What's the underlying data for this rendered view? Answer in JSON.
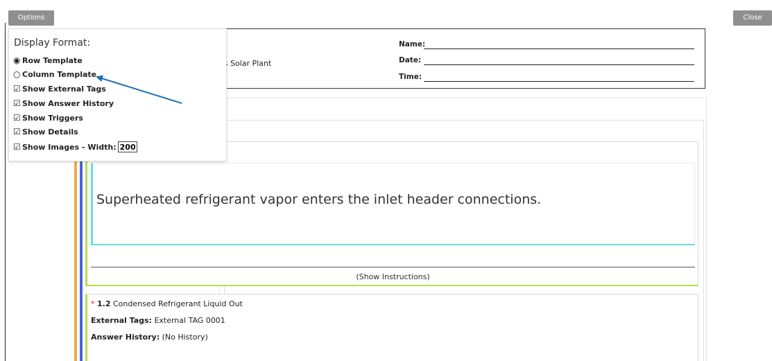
{
  "toolbar": {
    "options_label": "Options",
    "close_label": "Close"
  },
  "header": {
    "plant_text": "os Solar Plant",
    "signature_fields": [
      {
        "label": "Name:"
      },
      {
        "label": "Date:"
      },
      {
        "label": "Time:"
      }
    ]
  },
  "options_panel": {
    "title": "Display Format:",
    "row_template": {
      "label": "Row Template",
      "selected": true
    },
    "column_template": {
      "label": "Column Template",
      "selected": false
    },
    "checkboxes": [
      {
        "label": "Show External Tags",
        "checked": true
      },
      {
        "label": "Show Answer History",
        "checked": true
      },
      {
        "label": "Show Triggers",
        "checked": true
      },
      {
        "label": "Show Details",
        "checked": true
      },
      {
        "label": "Show Images - Width:",
        "checked": true
      }
    ],
    "image_width_value": "200"
  },
  "question1": {
    "text": "Superheated refrigerant vapor enters the inlet header connections.",
    "instructions_toggle": "(Show Instructions)"
  },
  "question2": {
    "required_marker": "*",
    "number": "1.2",
    "title": "Condensed Refrigerant Liquid Out",
    "external_tags_label": "External Tags:",
    "external_tags_value": "External TAG 0001",
    "answer_history_label": "Answer History:",
    "answer_history_value": "(No History)"
  },
  "colors": {
    "button_gray": "#8f8f8f",
    "level_orange": "#f0a948",
    "level_blue": "#4a64dc",
    "card_green": "#b5e04a",
    "text_cyan": "#64e0e0",
    "arrow_blue": "#1f6fb5",
    "required_red": "#dd2222"
  }
}
